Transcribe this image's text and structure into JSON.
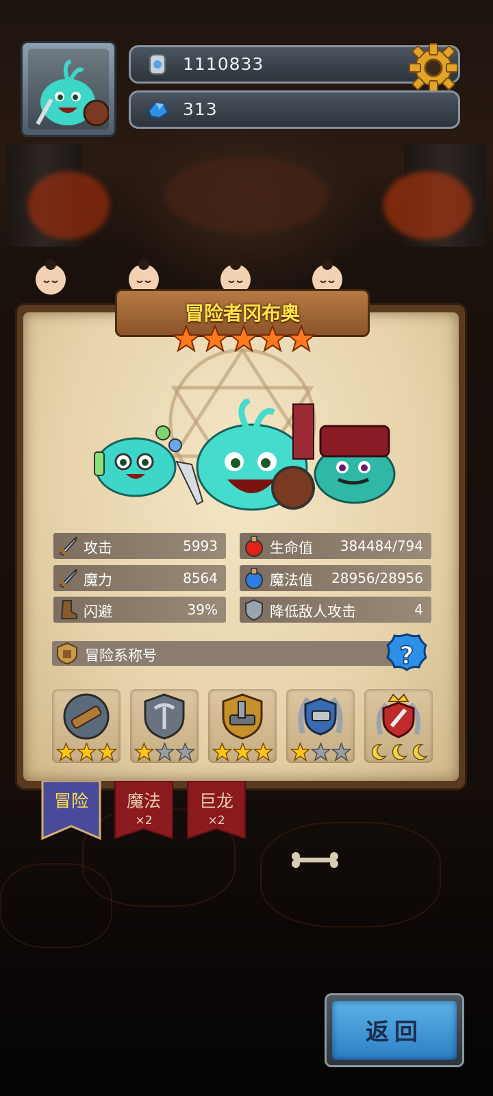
{
  "hud": {
    "coins": "1110833",
    "gems": "313",
    "coin_icon": "silver-coin-icon",
    "gem_icon": "blue-crystal-icon",
    "settings_icon": "gear-icon"
  },
  "character": {
    "name": "冒险者冈布奥",
    "star_count": 5
  },
  "stats": {
    "attack_label": "攻击",
    "attack_value": "5993",
    "hp_label": "生命值",
    "hp_value": "384484/794",
    "magic_label": "魔力",
    "magic_value": "8564",
    "mp_label": "魔法值",
    "mp_value": "28956/28956",
    "dodge_label": "闪避",
    "dodge_value": "39%",
    "reduce_label": "降低敌人攻击",
    "reduce_value": "4"
  },
  "titles": {
    "label": "冒险系称号",
    "help_icon": "question-mark-icon",
    "badges": [
      {
        "name": "telescope-badge",
        "stars_filled": 3,
        "star_style": "star"
      },
      {
        "name": "pickaxe-shield-badge",
        "stars_filled": 1,
        "star_style": "star"
      },
      {
        "name": "anvil-hammer-badge",
        "stars_filled": 3,
        "star_style": "star"
      },
      {
        "name": "cannon-laurel-badge",
        "stars_filled": 1,
        "star_style": "star"
      },
      {
        "name": "crown-sword-badge",
        "stars_filled": 0,
        "star_style": "moon"
      }
    ]
  },
  "tabs": [
    {
      "label": "冒险",
      "count": ""
    },
    {
      "label": "魔法",
      "count": "×2"
    },
    {
      "label": "巨龙",
      "count": "×2"
    }
  ],
  "buttons": {
    "back": "返回"
  },
  "colors": {
    "title_gold": "#ffe14a",
    "star_orange": "#ff7a1e",
    "gem_blue": "#2f8fe0"
  }
}
